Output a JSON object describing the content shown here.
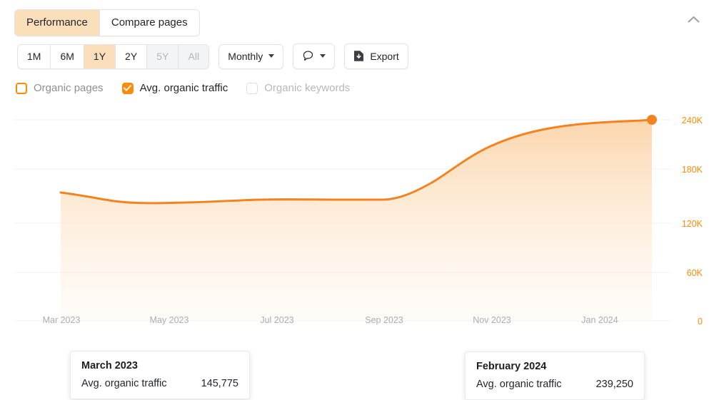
{
  "header": {
    "tabs": [
      {
        "label": "Performance",
        "active": true
      },
      {
        "label": "Compare pages",
        "active": false
      }
    ],
    "collapse_icon": "chevron-up-icon"
  },
  "controls": {
    "ranges": [
      {
        "label": "1M",
        "state": "normal"
      },
      {
        "label": "6M",
        "state": "normal"
      },
      {
        "label": "1Y",
        "state": "active"
      },
      {
        "label": "2Y",
        "state": "normal"
      },
      {
        "label": "5Y",
        "state": "disabled"
      },
      {
        "label": "All",
        "state": "disabled"
      }
    ],
    "granularity": {
      "label": "Monthly",
      "icon": "chevron-down-icon"
    },
    "annotations": {
      "icon": "speech-bubble-icon"
    },
    "export": {
      "label": "Export",
      "icon": "download-file-icon"
    }
  },
  "legend": [
    {
      "label": "Organic pages",
      "state": "unchecked"
    },
    {
      "label": "Avg. organic traffic",
      "state": "checked"
    },
    {
      "label": "Organic keywords",
      "state": "disabled"
    }
  ],
  "colors": {
    "accent": "#ff8b0a",
    "accent_active_bg": "#fbdfbb",
    "line": "#f58220",
    "area_top": "#fcdcb9",
    "grid": "#f0f1f2",
    "ytick": "#ff8b0a",
    "xtick": "#a9aeb3"
  },
  "tooltips": [
    {
      "title": "March 2023",
      "metric_label": "Avg. organic traffic",
      "metric_value": "145,775"
    },
    {
      "title": "February 2024",
      "metric_label": "Avg. organic traffic",
      "metric_value": "239,250"
    }
  ],
  "chart_data": {
    "type": "area",
    "title": "",
    "xlabel": "",
    "ylabel": "",
    "series_name": "Avg. organic traffic",
    "ylim": [
      0,
      240000
    ],
    "ytick_labels": [
      "240K",
      "180K",
      "120K",
      "60K",
      "0"
    ],
    "ytick_values": [
      240000,
      180000,
      120000,
      60000,
      0
    ],
    "xtick_labels": [
      "Mar 2023",
      "May 2023",
      "Jul 2023",
      "Sep 2023",
      "Nov 2023",
      "Jan 2024"
    ],
    "grid": true,
    "legend_position": "top",
    "categories": [
      "Mar 2023",
      "Apr 2023",
      "May 2023",
      "Jun 2023",
      "Jul 2023",
      "Aug 2023",
      "Sep 2023",
      "Oct 2023",
      "Nov 2023",
      "Dec 2023",
      "Jan 2024",
      "Feb 2024"
    ],
    "values": [
      145775,
      139000,
      135500,
      136500,
      140000,
      141000,
      140500,
      158000,
      196000,
      222000,
      232000,
      239250
    ],
    "highlighted_points": [
      {
        "category": "Mar 2023",
        "value": 145775
      },
      {
        "category": "Feb 2024",
        "value": 239250
      }
    ],
    "end_marker": {
      "category": "Feb 2024",
      "value": 239250
    }
  }
}
